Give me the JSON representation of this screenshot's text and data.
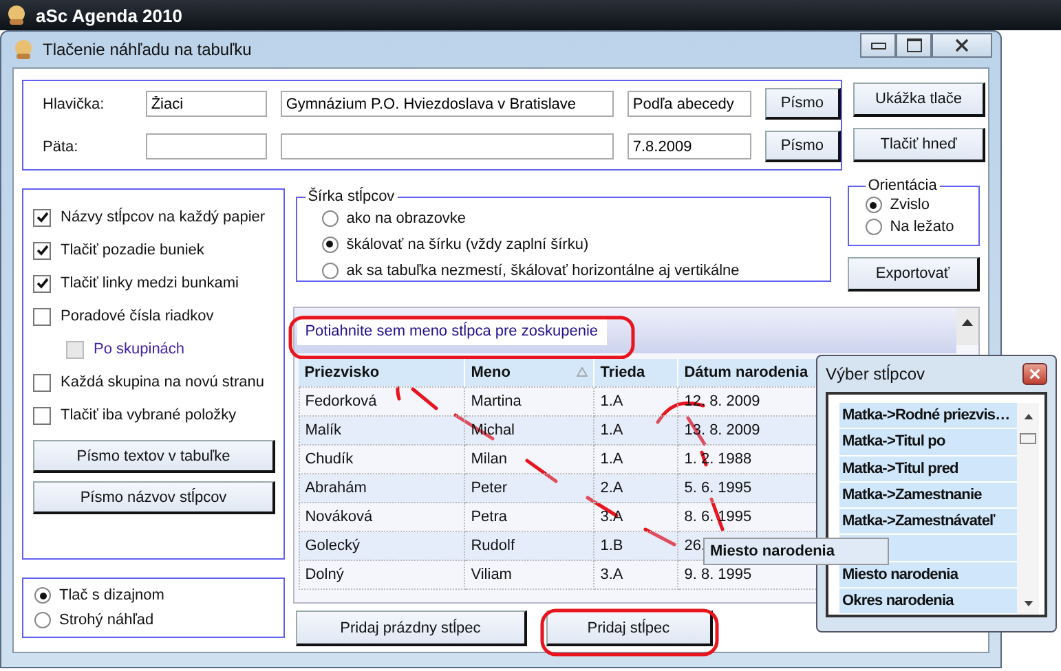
{
  "app": {
    "title": "aSc Agenda 2010"
  },
  "dialog": {
    "title": "Tlačenie náhľadu na tabuľku"
  },
  "header_rows": [
    {
      "label": "Hlavička:",
      "fields": {
        "field_1": "Žiaci",
        "field_2": "Gymnázium P.O. Hviezdoslava v Bratislave",
        "field_3": "Podľa abecedy"
      },
      "button": "Písmo"
    },
    {
      "label": "Päta:",
      "fields": {
        "field_3": "7.8.2009"
      },
      "button": "Písmo"
    }
  ],
  "actions": [
    "Ukážka tlače",
    "Tlačiť hneď"
  ],
  "options": [
    {
      "label": "Názvy stĺpcov na každý papier",
      "checked": true,
      "disabled": false
    },
    {
      "label": "Tlačiť pozadie buniek",
      "checked": true,
      "disabled": false
    },
    {
      "label": "Tlačiť linky medzi bunkami",
      "checked": true,
      "disabled": false
    },
    {
      "label": "Poradové čísla riadkov",
      "checked": false,
      "disabled": false,
      "children": [
        {
          "label": "Po skupinách",
          "checked": false,
          "disabled": true
        }
      ]
    },
    {
      "label": "Každá skupina na novú stranu",
      "checked": false,
      "disabled": false
    },
    {
      "label": "Tlačiť iba vybrané položky",
      "checked": false,
      "disabled": false
    }
  ],
  "font_buttons": [
    "Písmo textov v tabuľke",
    "Písmo názvov stĺpcov"
  ],
  "print_mode": [
    {
      "label": "Tlač s dizajnom",
      "selected": true
    },
    {
      "label": "Strohý náhľad",
      "selected": false
    }
  ],
  "column_width": {
    "title": "Šírka stĺpcov",
    "options": [
      {
        "label": "ako na obrazovke",
        "selected": false
      },
      {
        "label": "škálovať na šírku (vždy zaplní šírku)",
        "selected": true
      },
      {
        "label": "ak sa tabuľka nezmestí, škálovať horizontálne aj vertikálne",
        "selected": false
      }
    ]
  },
  "orientation": {
    "title": "Orientácia",
    "options": [
      {
        "label": "Zvislo",
        "selected": true
      },
      {
        "label": "Na ležato",
        "selected": false
      }
    ]
  },
  "export_button": "Exportovať",
  "grid": {
    "group_hint": "Potiahnite sem meno stĺpca pre zoskupenie",
    "columns": [
      {
        "label": "Priezvisko",
        "sorted": false
      },
      {
        "label": "Meno",
        "sorted": true
      },
      {
        "label": "Trieda",
        "sorted": false
      },
      {
        "label": "Dátum narodenia",
        "sorted": false
      }
    ],
    "rows": [
      [
        "Fedorková",
        "Martina",
        "1.A",
        "12. 8. 2009"
      ],
      [
        "Malík",
        "Michal",
        "1.A",
        "13. 8. 2009"
      ],
      [
        "Chudík",
        "Milan",
        "1.A",
        "1. 2. 1988"
      ],
      [
        "Abrahám",
        "Peter",
        "2.A",
        "5. 6. 1995"
      ],
      [
        "Nováková",
        "Petra",
        "3.A",
        "8. 6. 1995"
      ],
      [
        "Golecký",
        "Rudolf",
        "1.B",
        "26."
      ],
      [
        "Dolný",
        "Viliam",
        "3.A",
        "9. 8. 1995"
      ]
    ]
  },
  "bottom_buttons": [
    "Pridaj prázdny stĺpec",
    "Pridaj stĺpec"
  ],
  "column_chooser": {
    "title": "Výber stĺpcov",
    "items": [
      {
        "kind": "column",
        "label": "Matka->Rodné priezvis…"
      },
      {
        "kind": "column",
        "label": "Matka->Titul po"
      },
      {
        "kind": "column",
        "label": "Matka->Titul pred"
      },
      {
        "kind": "column",
        "label": "Matka->Zamestnanie"
      },
      {
        "kind": "column",
        "label": "Matka->Zamestnávateľ"
      },
      {
        "kind": "slot"
      },
      {
        "kind": "column",
        "label": "Miesto narodenia"
      },
      {
        "kind": "column",
        "label": "Okres narodenia"
      }
    ]
  },
  "drag_ghost": {
    "label": "Miesto narodenia"
  }
}
